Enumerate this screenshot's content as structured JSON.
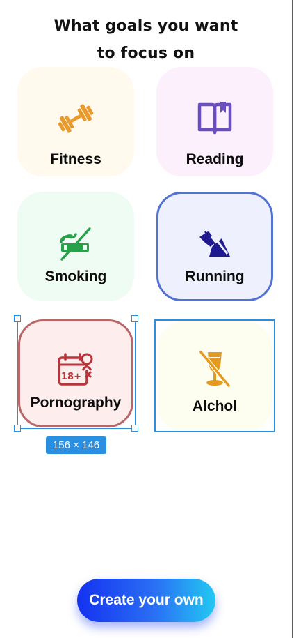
{
  "header": {
    "title_line1": "What goals you want",
    "title_line2": "to focus on"
  },
  "goals": [
    {
      "label": "Fitness",
      "icon": "dumbbell-icon",
      "color": "#e89a2c",
      "background": "#fff9ee",
      "selected": false
    },
    {
      "label": "Reading",
      "icon": "book-icon",
      "color": "#6b4fbf",
      "background": "#fdf0fd",
      "selected": false
    },
    {
      "label": "Smoking",
      "icon": "no-smoking-icon",
      "color": "#27a24a",
      "background": "#effcf3",
      "selected": false
    },
    {
      "label": "Running",
      "icon": "running-icon",
      "color": "#1f1a8f",
      "background": "#eef0fe",
      "selected": true
    },
    {
      "label": "Pornography",
      "icon": "adult-content-icon",
      "color": "#b8333a",
      "background": "#fdeded",
      "selected": true
    },
    {
      "label": "Alchol",
      "icon": "no-alcohol-icon",
      "color": "#e39a1f",
      "background": "#fdfdf0",
      "selected": false
    }
  ],
  "editor_overlay": {
    "size_label": "156 × 146",
    "selection_color": "#2a8fe0"
  },
  "cta": {
    "label": "Create your own",
    "gradient_start": "#1432f0",
    "gradient_end": "#22c9f2"
  }
}
